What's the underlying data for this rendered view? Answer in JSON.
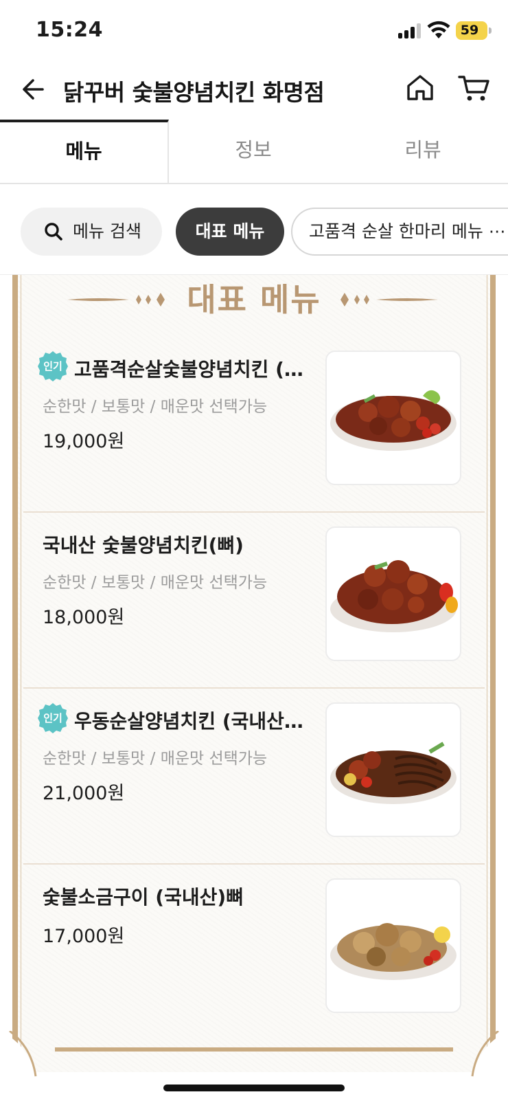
{
  "status_bar": {
    "time": "15:24",
    "battery": "59",
    "battery_color": "#f4d34a"
  },
  "header": {
    "title": "닭꾸버 숯불양념치킨 화명점"
  },
  "tabs": [
    {
      "label": "메뉴",
      "active": true
    },
    {
      "label": "정보",
      "active": false
    },
    {
      "label": "리뷰",
      "active": false
    }
  ],
  "chips": {
    "search": "메뉴 검색",
    "active": "대표 메뉴",
    "next": "고품격 순살 한마리 메뉴 ⋯"
  },
  "section": {
    "title": "대표 메뉴",
    "accent_color": "#b89772"
  },
  "menu_items": [
    {
      "name": "고품격순살숯불양념치킨 (…",
      "badge": "인기",
      "desc": "순한맛 / 보통맛 / 매운맛 선택가능",
      "price": "19,000원"
    },
    {
      "name": "국내산 숯불양념치킨(뼈)",
      "badge": "",
      "desc": "순한맛 / 보통맛 / 매운맛 선택가능",
      "price": "18,000원"
    },
    {
      "name": "우동순살양념치킨 (국내산…",
      "badge": "인기",
      "desc": "순한맛 / 보통맛 / 매운맛 선택가능",
      "price": "21,000원"
    },
    {
      "name": "숯불소금구이 (국내산)뼈",
      "badge": "",
      "desc": "",
      "price": "17,000원"
    }
  ],
  "badge_color": "#5cc3c5"
}
